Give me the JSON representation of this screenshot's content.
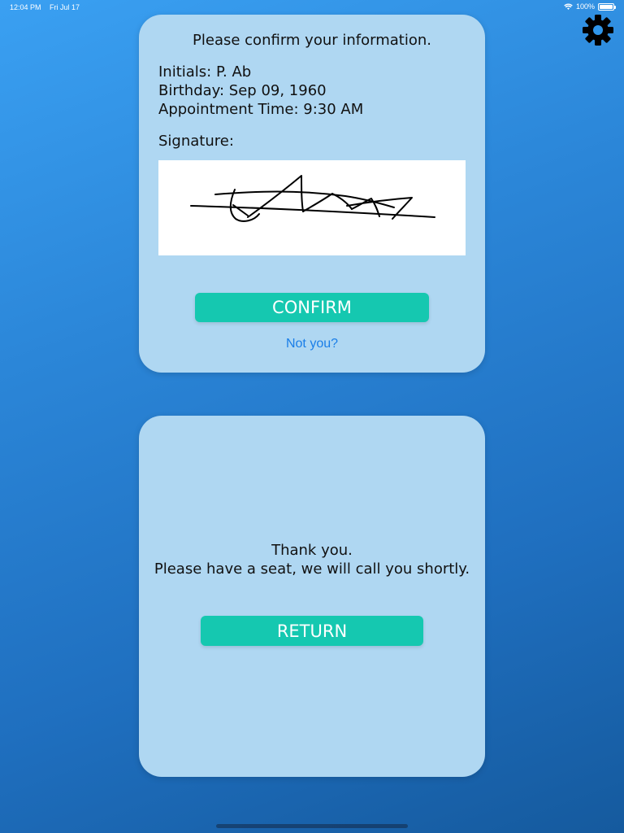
{
  "status_bar": {
    "time": "12:04 PM",
    "date": "Fri Jul 17",
    "battery": "100%",
    "battery_level": 1.0
  },
  "settings": {
    "icon": "gear-icon"
  },
  "confirm_card": {
    "heading": "Please confirm your information.",
    "initials": "Initials: P. Ab",
    "birthday": "Birthday: Sep 09, 1960",
    "appointment": "Appointment Time: 9:30 AM",
    "signature_label": "Signature:",
    "confirm_label": "CONFIRM",
    "not_you_label": "Not you?"
  },
  "thanks_card": {
    "line1": "Thank you.",
    "line2": "Please have a seat, we will call you shortly.",
    "return_label": "RETURN"
  },
  "colors": {
    "accent_button": "#15c8b0",
    "card": "#afd7f2",
    "link": "#1a7ee8",
    "background_top": "#3aa0f2",
    "background_bottom": "#155a9e"
  }
}
